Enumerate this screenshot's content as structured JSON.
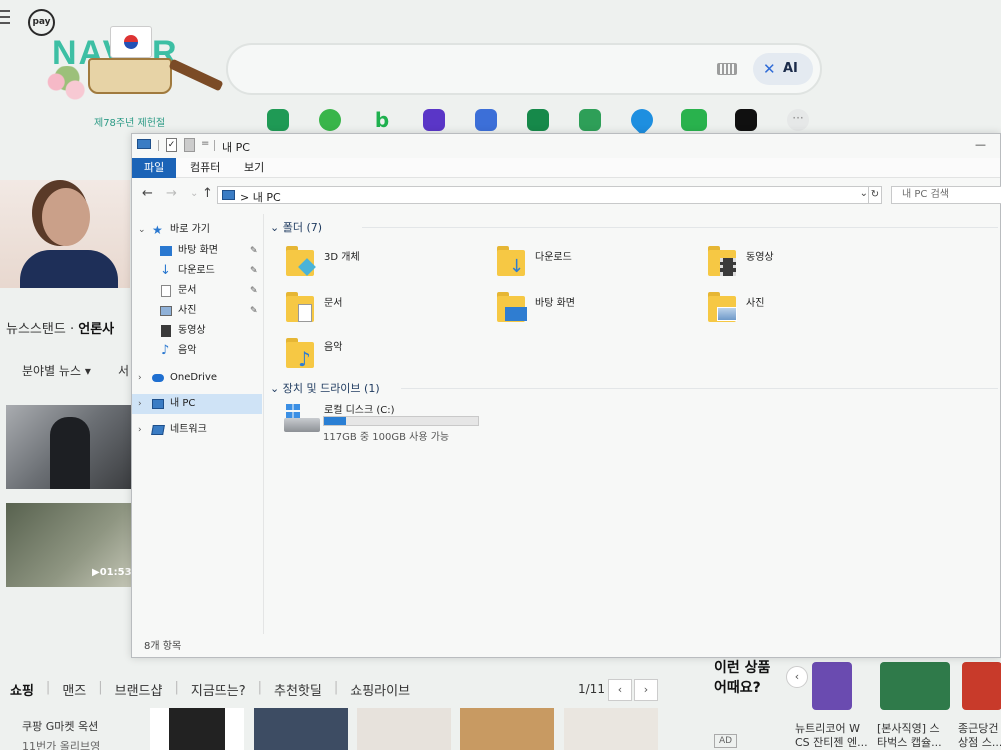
{
  "browser": {
    "pay_label": "pay",
    "logo_text": "NAVER",
    "logo_sub": "제78주년 제헌절",
    "search_ai": "AI",
    "newsstand_a": "뉴스스탠드",
    "newsstand_sep": "·",
    "newsstand_b": "언론사",
    "bunya": "분야별 뉴스 ▾",
    "bunya_r": "서",
    "video_time": "▶01:53",
    "shop_tabs": [
      "쇼핑",
      "맨즈",
      "브랜드샵",
      "지금뜨는?",
      "추천핫딜",
      "쇼핑라이브"
    ],
    "pager": "1/11",
    "pager_prev": "‹",
    "pager_next": "›",
    "shop_sub": "쿠팡   G마켓   옥션",
    "shop_sub2": "11번가   올리브영",
    "right_q": "이런 상품\n어때요?",
    "right_arrow": "‹",
    "ad": "AD",
    "right_caps": [
      "뉴트리코어 W\nCS 잔티젠 엔...",
      "[본사직영] 스\n타벅스 캡슐...",
      "종근당건\n상점 스..."
    ]
  },
  "explorer": {
    "title": "내 PC",
    "check_glyph": "✓",
    "dropdown_glyph": "=",
    "minimize_glyph": "—",
    "ribbon_tabs": [
      "파일",
      "컴퓨터",
      "보기"
    ],
    "nav_back": "←",
    "nav_forward": "→",
    "nav_up": "↑",
    "address_sep": ">",
    "address": "내 PC",
    "address_dd": "⌄",
    "refresh": "↻",
    "search_placeholder": "내 PC 검색",
    "nav": {
      "quick_access": "바로 가기",
      "quick_items": [
        "바탕 화면",
        "다운로드",
        "문서",
        "사진",
        "동영상",
        "음악"
      ],
      "onedrive": "OneDrive",
      "this_pc": "내 PC",
      "network": "네트워크",
      "pin_glyph": "✎"
    },
    "folders_header": "폴더 (7)",
    "folders": [
      {
        "name": "3D 개체",
        "overlay": "#4ab3d8"
      },
      {
        "name": "다운로드",
        "overlay": "#2f7dd1"
      },
      {
        "name": "동영상",
        "overlay": "#3a3a3a"
      },
      {
        "name": "문서",
        "overlay": "#ffffff"
      },
      {
        "name": "바탕 화면",
        "overlay": "#2f7dd1"
      },
      {
        "name": "사진",
        "overlay": "#6f9ac9"
      },
      {
        "name": "음악",
        "overlay": "#2f7dd1"
      }
    ],
    "devices_header": "장치 및 드라이브 (1)",
    "drive": {
      "name": "로컬 디스크 (C:)",
      "free_text": "117GB 중 100GB 사용 가능",
      "used_fraction": 0.145
    },
    "status": "8개 항목"
  }
}
